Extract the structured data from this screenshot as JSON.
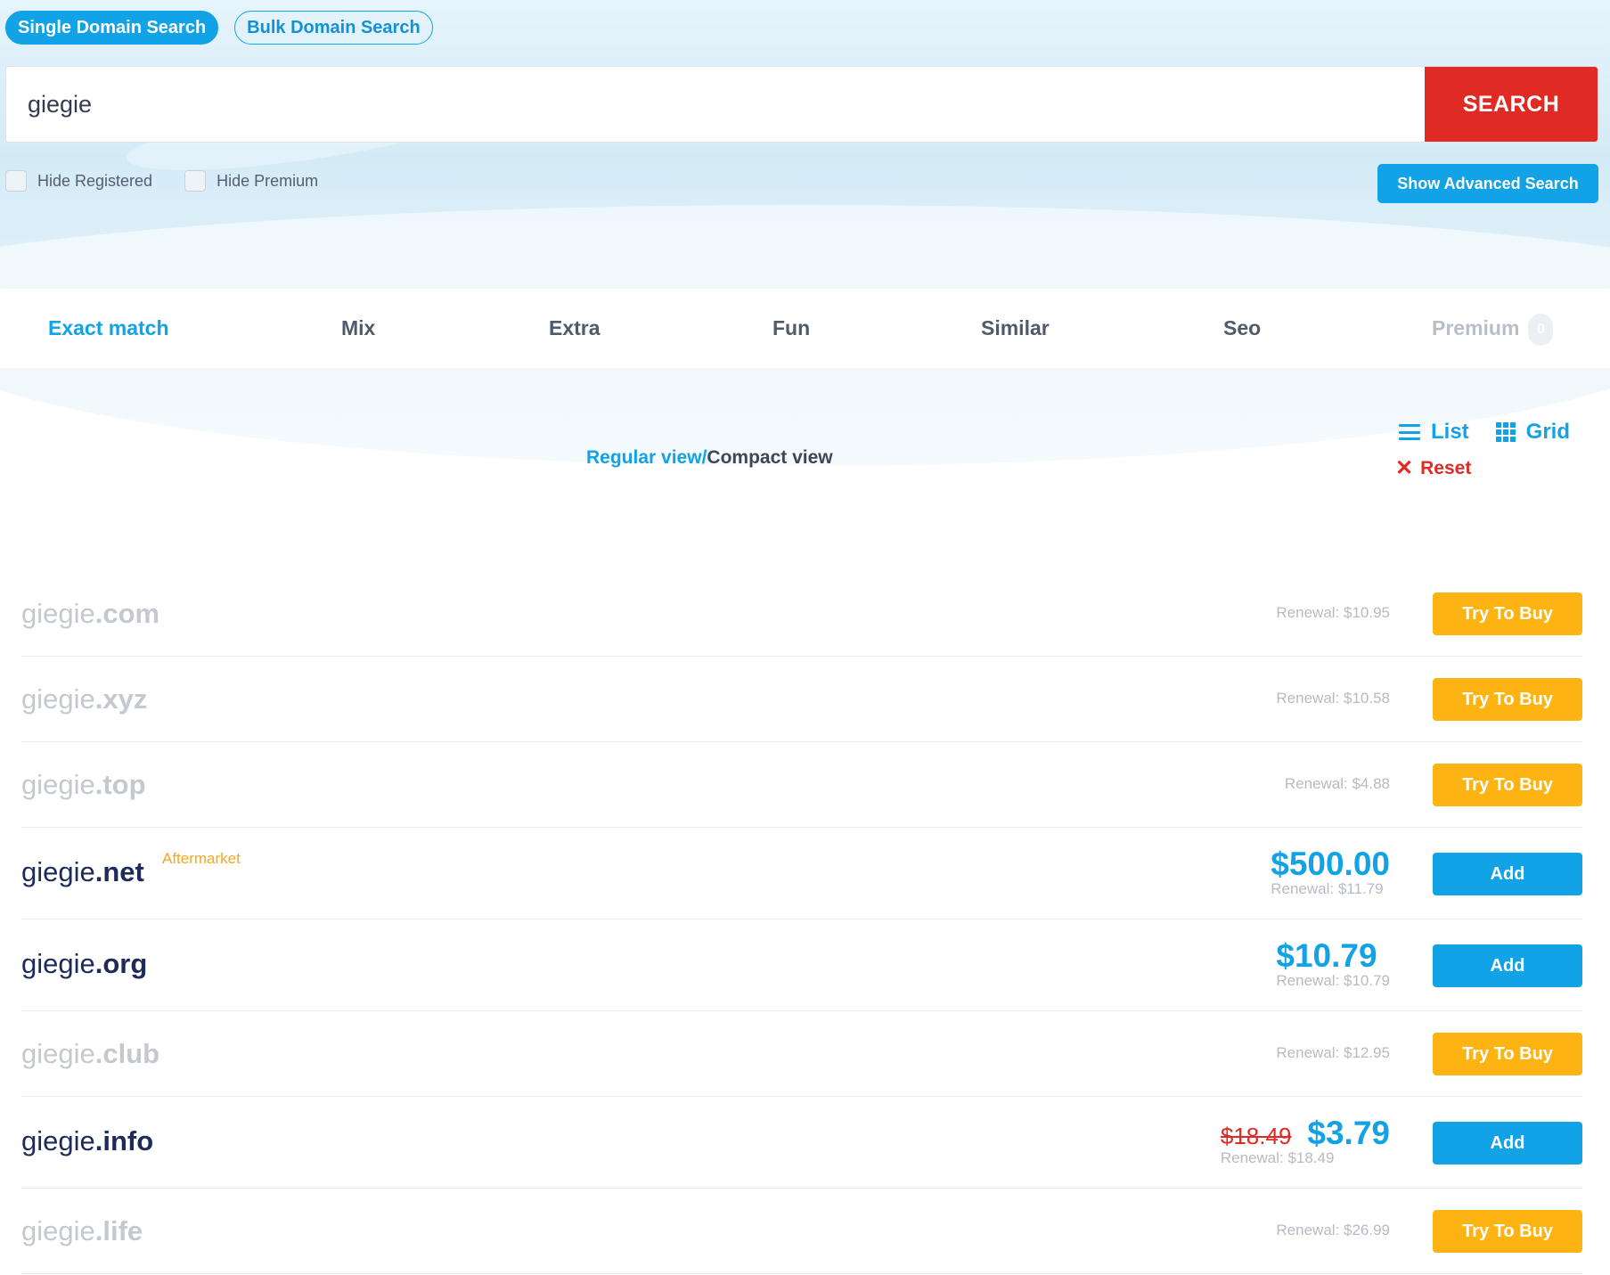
{
  "search_modes": {
    "single": "Single Domain Search",
    "bulk": "Bulk Domain Search"
  },
  "search": {
    "value": "giegie",
    "button": "SEARCH"
  },
  "filters": {
    "hide_registered": "Hide Registered",
    "hide_premium": "Hide Premium",
    "advanced_button": "Show Advanced Search"
  },
  "categories": {
    "exact": "Exact match",
    "mix": "Mix",
    "extra": "Extra",
    "fun": "Fun",
    "similar": "Similar",
    "seo": "Seo",
    "premium": "Premium",
    "premium_count": "0"
  },
  "view": {
    "regular": "Regular view",
    "separator": "/",
    "compact": "Compact view",
    "list": "List",
    "grid": "Grid",
    "reset": "Reset"
  },
  "colors": {
    "accent": "#12a2e6",
    "search_button": "#e02a24",
    "try_button": "#fdb413",
    "aftermarket": "#f5a623"
  },
  "results": [
    {
      "sld": "giegie",
      "tld": ".com",
      "status": "taken",
      "renewal": "Renewal: $10.95",
      "action": "Try To Buy"
    },
    {
      "sld": "giegie",
      "tld": ".xyz",
      "status": "taken",
      "renewal": "Renewal: $10.58",
      "action": "Try To Buy"
    },
    {
      "sld": "giegie",
      "tld": ".top",
      "status": "taken",
      "renewal": "Renewal: $4.88",
      "action": "Try To Buy"
    },
    {
      "sld": "giegie",
      "tld": ".net",
      "status": "available",
      "tag": "Aftermarket",
      "price": "$500.00",
      "renewal": "Renewal: $11.79",
      "action": "Add"
    },
    {
      "sld": "giegie",
      "tld": ".org",
      "status": "available",
      "price": "$10.79",
      "renewal": "Renewal: $10.79",
      "action": "Add"
    },
    {
      "sld": "giegie",
      "tld": ".club",
      "status": "taken",
      "renewal": "Renewal: $12.95",
      "action": "Try To Buy"
    },
    {
      "sld": "giegie",
      "tld": ".info",
      "status": "available",
      "old_price": "$18.49",
      "price": "$3.79",
      "renewal": "Renewal: $18.49",
      "action": "Add"
    },
    {
      "sld": "giegie",
      "tld": ".life",
      "status": "taken",
      "renewal": "Renewal: $26.99",
      "action": "Try To Buy"
    }
  ]
}
